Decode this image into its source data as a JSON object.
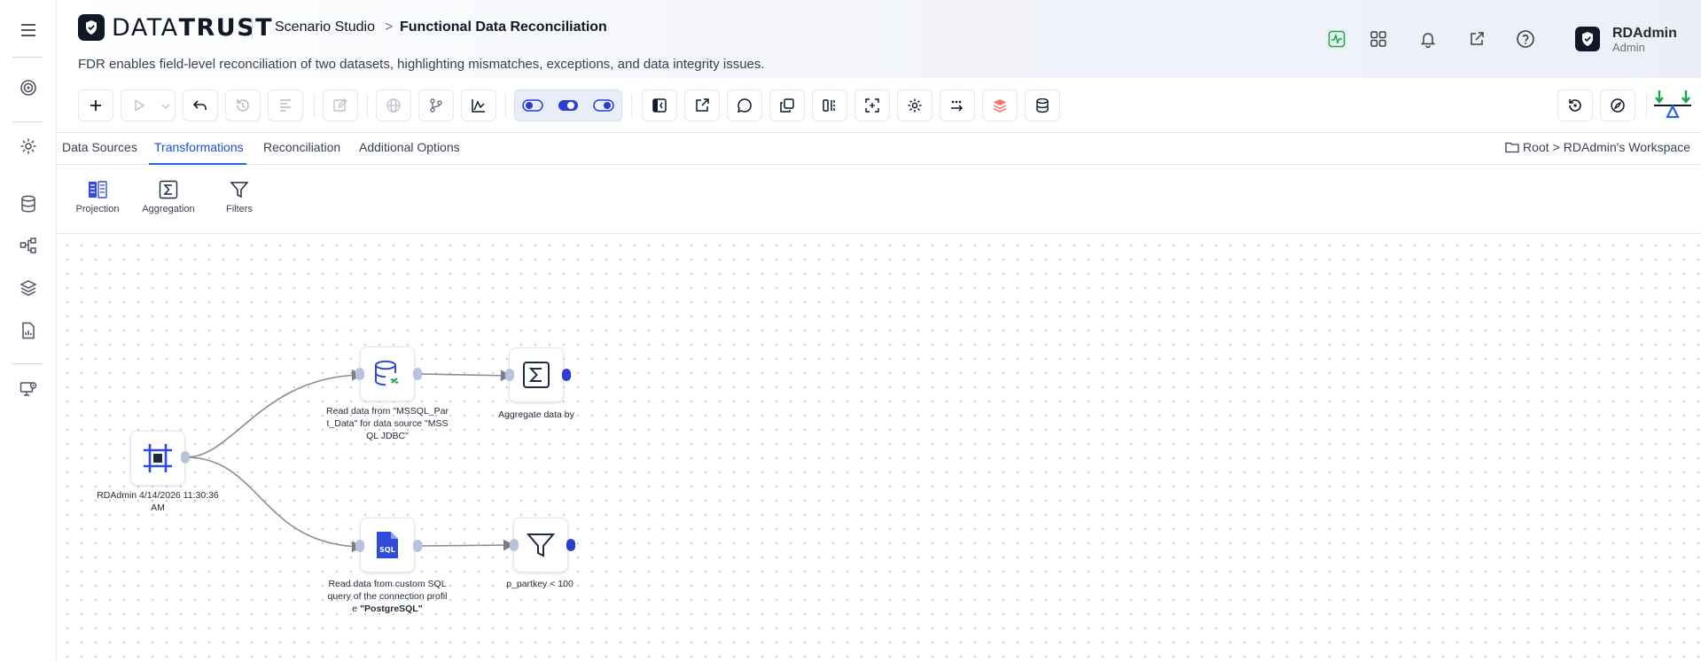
{
  "rail": {
    "items": [
      {
        "name": "menu-icon"
      },
      {
        "name": "target-icon"
      },
      {
        "name": "gear-icon"
      },
      {
        "name": "database-icon"
      },
      {
        "name": "nodes-icon"
      },
      {
        "name": "layers-icon"
      },
      {
        "name": "report-icon"
      },
      {
        "name": "monitor-settings-icon"
      }
    ]
  },
  "header": {
    "logo_part_a": "DATA",
    "logo_part_b": "TRUST",
    "breadcrumb_parent": "Scenario Studio",
    "breadcrumb_separator": ">",
    "breadcrumb_current": "Functional Data Reconciliation",
    "description": "FDR enables field-level reconciliation of two datasets, highlighting mismatches, exceptions, and data integrity issues.",
    "icons": [
      "activity-icon",
      "apps-grid-icon",
      "bell-icon",
      "external-link-icon",
      "help-icon"
    ],
    "user": {
      "name": "RDAdmin",
      "role": "Admin"
    }
  },
  "toolbar": {
    "buttons": [
      "add-icon",
      "run-icon",
      "chevron-down-icon",
      "undo-icon",
      "history-icon",
      "schema-icon",
      "edit-icon",
      "globe-icon",
      "branch-icon",
      "chart-icon",
      "toggle-left-icon",
      "toggle-center-icon",
      "toggle-right-icon",
      "collapse-panel-icon",
      "share-icon",
      "comment-icon",
      "copy-icon",
      "split-icon",
      "scan-icon",
      "settings-icon",
      "transfer-icon",
      "stack-icon",
      "database-icon",
      "restore-icon",
      "compass-icon",
      "reconcile-scale-icon"
    ],
    "accent": "#2a3fd1"
  },
  "tabs": {
    "items": [
      {
        "label": "Data Sources"
      },
      {
        "label": "Transformations"
      },
      {
        "label": "Reconciliation"
      },
      {
        "label": "Additional Options"
      }
    ],
    "active": "Transformations"
  },
  "workspace": {
    "root": "Root",
    "separator": ">",
    "name": "RDAdmin's Workspace"
  },
  "palette": {
    "items": [
      {
        "label": "Projection"
      },
      {
        "label": "Aggregation"
      },
      {
        "label": "Filters"
      }
    ]
  },
  "canvas": {
    "nodes": {
      "start": {
        "label": "RDAdmin 4/14/2026 11:30:36 AM"
      },
      "mssql_source": {
        "label": "Read data from \"MSSQL_Part_Data\" for data source \"MSSQL JDBC\""
      },
      "aggregate": {
        "label": "Aggregate data by"
      },
      "sql_source": {
        "label_prefix": "Read data from custom SQL query of the connection profile ",
        "label_bold": "\"PostgreSQL\""
      },
      "filter": {
        "label": "p_partkey < 100"
      }
    }
  }
}
